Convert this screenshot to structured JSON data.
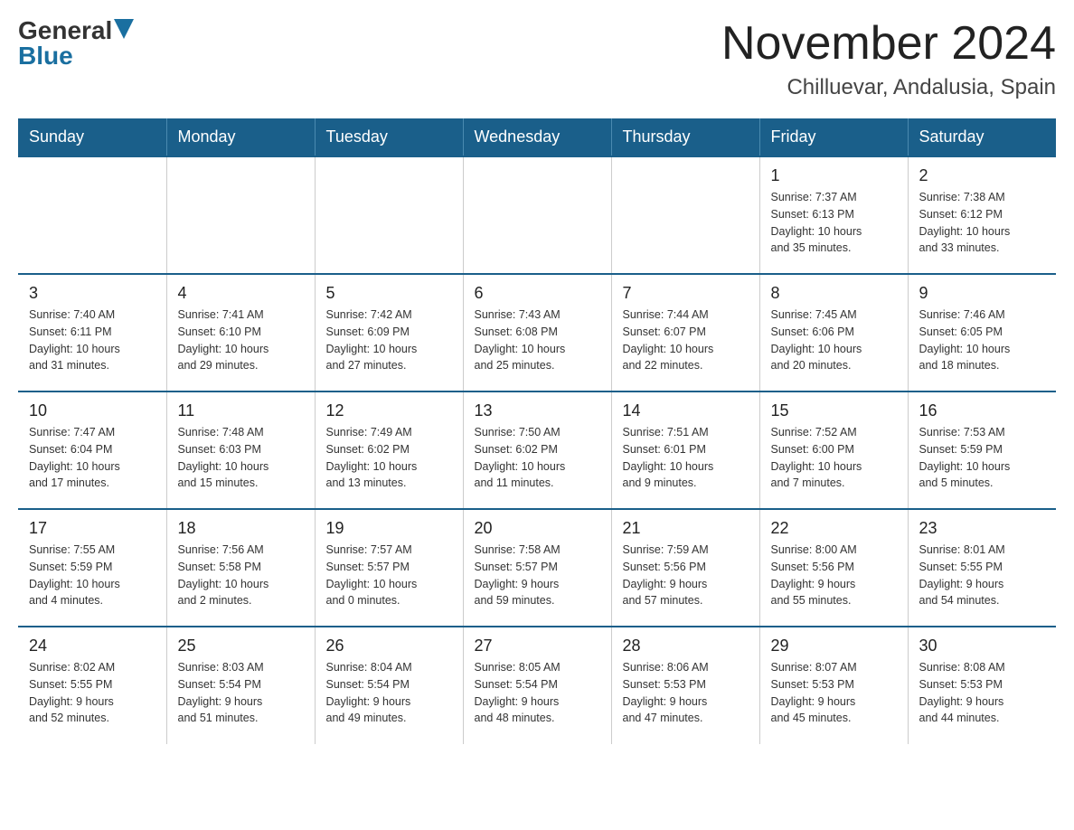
{
  "header": {
    "logo_general": "General",
    "logo_blue": "Blue",
    "month_title": "November 2024",
    "location": "Chilluevar, Andalusia, Spain"
  },
  "weekdays": [
    "Sunday",
    "Monday",
    "Tuesday",
    "Wednesday",
    "Thursday",
    "Friday",
    "Saturday"
  ],
  "weeks": [
    [
      {
        "day": "",
        "info": ""
      },
      {
        "day": "",
        "info": ""
      },
      {
        "day": "",
        "info": ""
      },
      {
        "day": "",
        "info": ""
      },
      {
        "day": "",
        "info": ""
      },
      {
        "day": "1",
        "info": "Sunrise: 7:37 AM\nSunset: 6:13 PM\nDaylight: 10 hours\nand 35 minutes."
      },
      {
        "day": "2",
        "info": "Sunrise: 7:38 AM\nSunset: 6:12 PM\nDaylight: 10 hours\nand 33 minutes."
      }
    ],
    [
      {
        "day": "3",
        "info": "Sunrise: 7:40 AM\nSunset: 6:11 PM\nDaylight: 10 hours\nand 31 minutes."
      },
      {
        "day": "4",
        "info": "Sunrise: 7:41 AM\nSunset: 6:10 PM\nDaylight: 10 hours\nand 29 minutes."
      },
      {
        "day": "5",
        "info": "Sunrise: 7:42 AM\nSunset: 6:09 PM\nDaylight: 10 hours\nand 27 minutes."
      },
      {
        "day": "6",
        "info": "Sunrise: 7:43 AM\nSunset: 6:08 PM\nDaylight: 10 hours\nand 25 minutes."
      },
      {
        "day": "7",
        "info": "Sunrise: 7:44 AM\nSunset: 6:07 PM\nDaylight: 10 hours\nand 22 minutes."
      },
      {
        "day": "8",
        "info": "Sunrise: 7:45 AM\nSunset: 6:06 PM\nDaylight: 10 hours\nand 20 minutes."
      },
      {
        "day": "9",
        "info": "Sunrise: 7:46 AM\nSunset: 6:05 PM\nDaylight: 10 hours\nand 18 minutes."
      }
    ],
    [
      {
        "day": "10",
        "info": "Sunrise: 7:47 AM\nSunset: 6:04 PM\nDaylight: 10 hours\nand 17 minutes."
      },
      {
        "day": "11",
        "info": "Sunrise: 7:48 AM\nSunset: 6:03 PM\nDaylight: 10 hours\nand 15 minutes."
      },
      {
        "day": "12",
        "info": "Sunrise: 7:49 AM\nSunset: 6:02 PM\nDaylight: 10 hours\nand 13 minutes."
      },
      {
        "day": "13",
        "info": "Sunrise: 7:50 AM\nSunset: 6:02 PM\nDaylight: 10 hours\nand 11 minutes."
      },
      {
        "day": "14",
        "info": "Sunrise: 7:51 AM\nSunset: 6:01 PM\nDaylight: 10 hours\nand 9 minutes."
      },
      {
        "day": "15",
        "info": "Sunrise: 7:52 AM\nSunset: 6:00 PM\nDaylight: 10 hours\nand 7 minutes."
      },
      {
        "day": "16",
        "info": "Sunrise: 7:53 AM\nSunset: 5:59 PM\nDaylight: 10 hours\nand 5 minutes."
      }
    ],
    [
      {
        "day": "17",
        "info": "Sunrise: 7:55 AM\nSunset: 5:59 PM\nDaylight: 10 hours\nand 4 minutes."
      },
      {
        "day": "18",
        "info": "Sunrise: 7:56 AM\nSunset: 5:58 PM\nDaylight: 10 hours\nand 2 minutes."
      },
      {
        "day": "19",
        "info": "Sunrise: 7:57 AM\nSunset: 5:57 PM\nDaylight: 10 hours\nand 0 minutes."
      },
      {
        "day": "20",
        "info": "Sunrise: 7:58 AM\nSunset: 5:57 PM\nDaylight: 9 hours\nand 59 minutes."
      },
      {
        "day": "21",
        "info": "Sunrise: 7:59 AM\nSunset: 5:56 PM\nDaylight: 9 hours\nand 57 minutes."
      },
      {
        "day": "22",
        "info": "Sunrise: 8:00 AM\nSunset: 5:56 PM\nDaylight: 9 hours\nand 55 minutes."
      },
      {
        "day": "23",
        "info": "Sunrise: 8:01 AM\nSunset: 5:55 PM\nDaylight: 9 hours\nand 54 minutes."
      }
    ],
    [
      {
        "day": "24",
        "info": "Sunrise: 8:02 AM\nSunset: 5:55 PM\nDaylight: 9 hours\nand 52 minutes."
      },
      {
        "day": "25",
        "info": "Sunrise: 8:03 AM\nSunset: 5:54 PM\nDaylight: 9 hours\nand 51 minutes."
      },
      {
        "day": "26",
        "info": "Sunrise: 8:04 AM\nSunset: 5:54 PM\nDaylight: 9 hours\nand 49 minutes."
      },
      {
        "day": "27",
        "info": "Sunrise: 8:05 AM\nSunset: 5:54 PM\nDaylight: 9 hours\nand 48 minutes."
      },
      {
        "day": "28",
        "info": "Sunrise: 8:06 AM\nSunset: 5:53 PM\nDaylight: 9 hours\nand 47 minutes."
      },
      {
        "day": "29",
        "info": "Sunrise: 8:07 AM\nSunset: 5:53 PM\nDaylight: 9 hours\nand 45 minutes."
      },
      {
        "day": "30",
        "info": "Sunrise: 8:08 AM\nSunset: 5:53 PM\nDaylight: 9 hours\nand 44 minutes."
      }
    ]
  ]
}
